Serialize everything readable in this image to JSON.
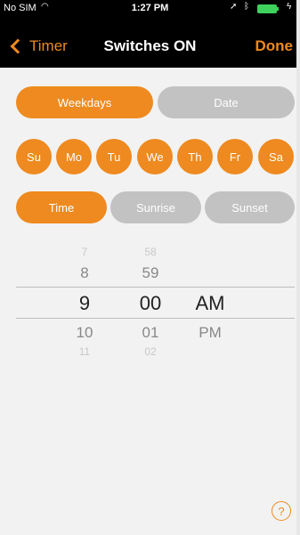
{
  "status_bar": {
    "carrier": "No SIM",
    "time": "1:27 PM"
  },
  "nav": {
    "back_label": "Timer",
    "title": "Switches ON",
    "done_label": "Done"
  },
  "schedule_type": {
    "options": [
      {
        "label": "Weekdays",
        "selected": true
      },
      {
        "label": "Date",
        "selected": false
      }
    ]
  },
  "days": [
    {
      "label": "Su",
      "selected": true
    },
    {
      "label": "Mo",
      "selected": true
    },
    {
      "label": "Tu",
      "selected": true
    },
    {
      "label": "We",
      "selected": true
    },
    {
      "label": "Th",
      "selected": true
    },
    {
      "label": "Fr",
      "selected": true
    },
    {
      "label": "Sa",
      "selected": true
    }
  ],
  "trigger_type": {
    "options": [
      {
        "label": "Time",
        "selected": true
      },
      {
        "label": "Sunrise",
        "selected": false
      },
      {
        "label": "Sunset",
        "selected": false
      }
    ]
  },
  "time_picker": {
    "hours": [
      "7",
      "8",
      "9",
      "10",
      "11"
    ],
    "minutes": [
      "58",
      "59",
      "00",
      "01",
      "02"
    ],
    "periods": [
      "AM",
      "PM"
    ],
    "selected": {
      "hour": "9",
      "minute": "00",
      "period": "AM"
    }
  },
  "help": {
    "label": "?"
  },
  "colors": {
    "accent": "#ee8a1f",
    "inactive": "#c2c2c2",
    "background": "#f2f2f2"
  },
  "icons": {
    "wifi": "wifi-icon",
    "location": "location-arrow-icon",
    "bluetooth": "bluetooth-icon",
    "battery": "battery-icon",
    "back": "chevron-left-icon",
    "help": "question-circle-icon"
  }
}
